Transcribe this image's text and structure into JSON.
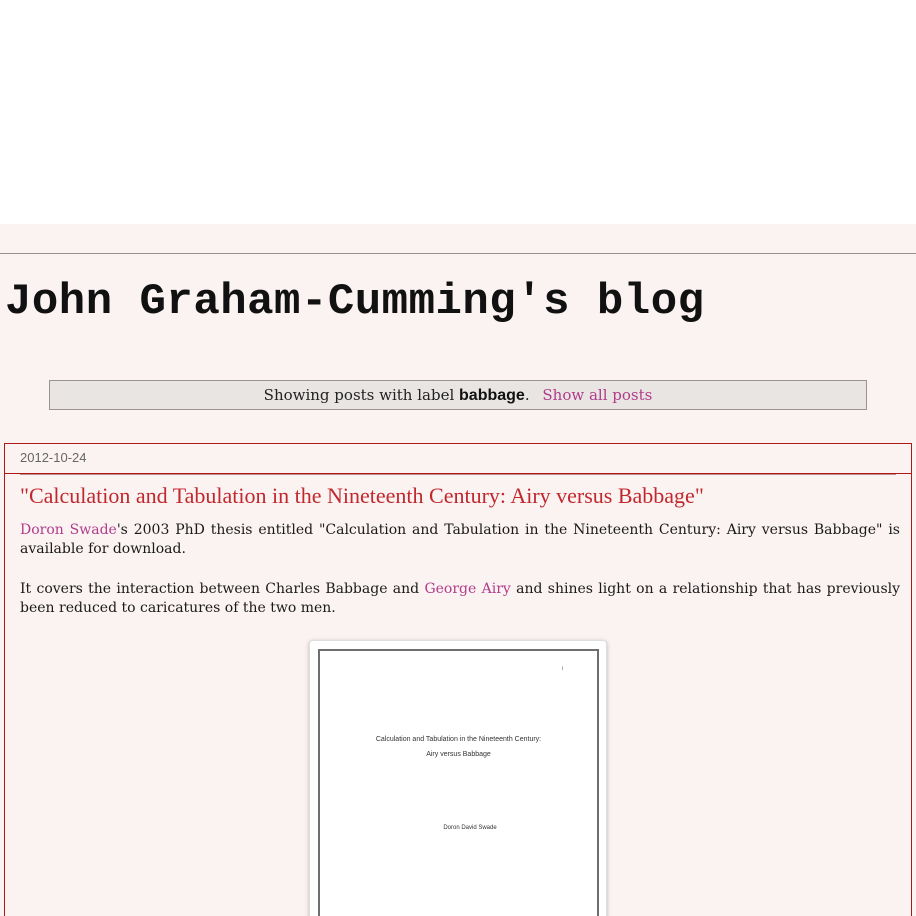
{
  "blog": {
    "title": "John Graham-Cumming's blog"
  },
  "status": {
    "prefix": "Showing posts with label",
    "label": "babbage",
    "suffix": ".",
    "show_all": "Show all posts"
  },
  "post": {
    "date": "2012-10-24",
    "title": "\"Calculation and Tabulation in the Nineteenth Century: Airy versus Babbage\"",
    "p1_link": "Doron Swade",
    "p1_text": "'s 2003 PhD thesis entitled \"Calculation and Tabulation in the Nineteenth Century: Airy versus Babbage\" is available for download.",
    "p2_before": "It covers the interaction between Charles Babbage and ",
    "p2_link": "George Airy",
    "p2_after": " and shines light on a relationship that has previously been reduced to caricatures of the two men.",
    "thumbnail": {
      "page_number": "i",
      "title_line1": "Calculation and Tabulation in the Nineteenth Century:",
      "title_line2": "Airy versus Babbage",
      "author": "Doron David Swade"
    }
  },
  "colors": {
    "page_bg": "#fbf3f2",
    "link": "#b03c8a",
    "post_title": "#c0282e",
    "post_border": "#b01818"
  }
}
